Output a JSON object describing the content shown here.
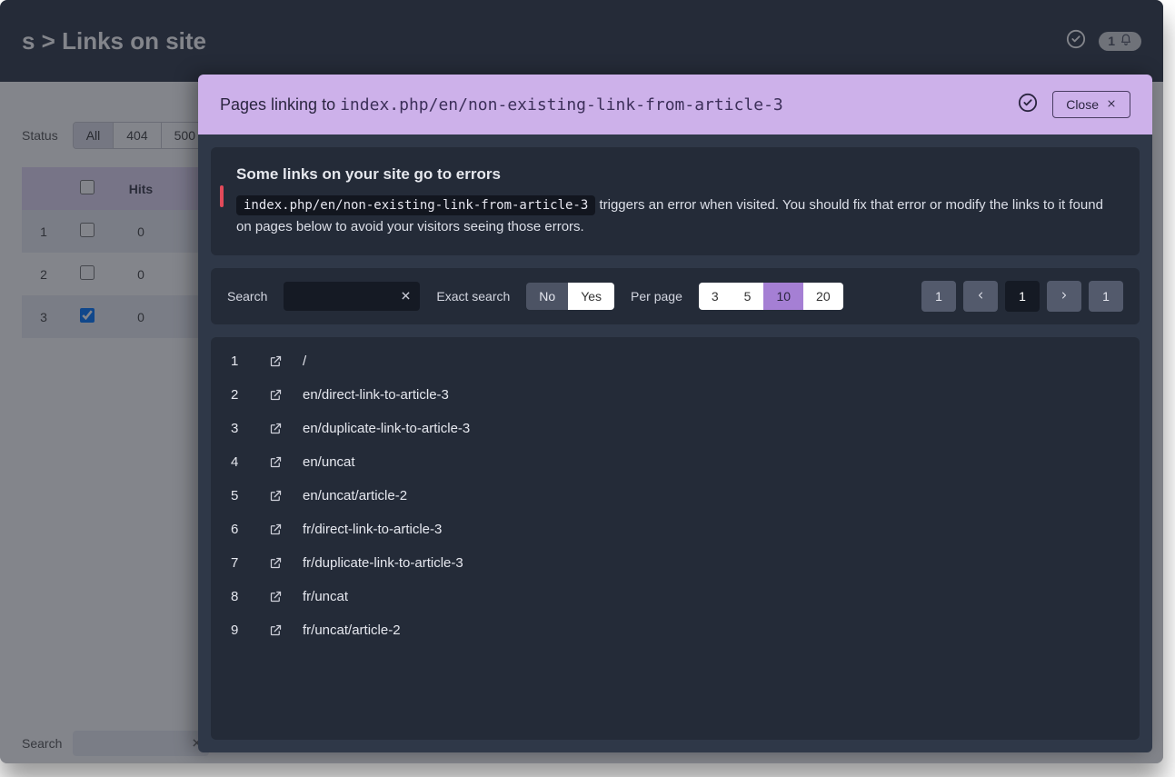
{
  "bg": {
    "breadcrumb": "s  >  Links on site",
    "notif_count": "1",
    "filters": {
      "status_label": "Status",
      "status_options": [
        "All",
        "404",
        "500"
      ],
      "status_selected": 0
    },
    "table": {
      "headers": {
        "hits": "Hits"
      },
      "rows": [
        {
          "num": "1",
          "checked": false,
          "hits": "0"
        },
        {
          "num": "2",
          "checked": false,
          "hits": "0"
        },
        {
          "num": "3",
          "checked": true,
          "hits": "0"
        }
      ]
    },
    "search_label": "Search"
  },
  "modal": {
    "title_prefix": "Pages linking to ",
    "title_path": "index.php/en/non-existing-link-from-article-3",
    "close_label": "Close",
    "alert": {
      "heading": "Some links on your site go to errors",
      "code": "index.php/en/non-existing-link-from-article-3",
      "text_after_code": " triggers an error when visited. You should fix that error or modify the links to it found on pages below to avoid your visitors seeing those errors."
    },
    "toolbar": {
      "search_label": "Search",
      "exact_label": "Exact search",
      "exact_options": [
        "No",
        "Yes"
      ],
      "exact_selected": 0,
      "perpage_label": "Per page",
      "perpage_options": [
        "3",
        "5",
        "10",
        "20"
      ],
      "perpage_selected": 2,
      "pager": {
        "first": "1",
        "current": "1",
        "last": "1"
      }
    },
    "results": [
      {
        "idx": "1",
        "path": "/"
      },
      {
        "idx": "2",
        "path": "en/direct-link-to-article-3"
      },
      {
        "idx": "3",
        "path": "en/duplicate-link-to-article-3"
      },
      {
        "idx": "4",
        "path": "en/uncat"
      },
      {
        "idx": "5",
        "path": "en/uncat/article-2"
      },
      {
        "idx": "6",
        "path": "fr/direct-link-to-article-3"
      },
      {
        "idx": "7",
        "path": "fr/duplicate-link-to-article-3"
      },
      {
        "idx": "8",
        "path": "fr/uncat"
      },
      {
        "idx": "9",
        "path": "fr/uncat/article-2"
      }
    ]
  }
}
